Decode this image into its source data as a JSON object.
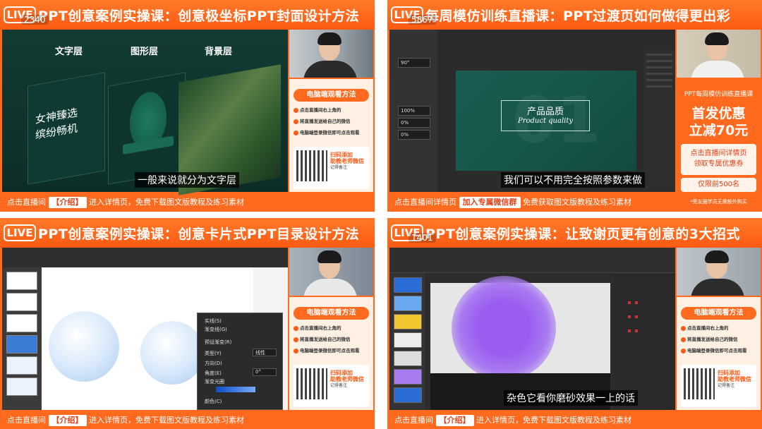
{
  "tiles": [
    {
      "live": "LIVE",
      "viewers": "2340",
      "title": "PPT创意案例实操课：创意极坐标PPT封面设计方法",
      "layers": [
        "文字层",
        "图形层",
        "背景层"
      ],
      "slide_text": "女神臻选\n缤纷畅机",
      "caption": "一般来说就分为文字层",
      "bottom_prefix": "点击直播间",
      "bottom_tag": "【介绍】",
      "bottom_suffix": "进入详情页，免费下载图文版教程及练习素材"
    },
    {
      "live": "LIVE",
      "viewers": "5867",
      "title": "每周模仿训练直播课：PPT过渡页如何做得更出彩",
      "fields": [
        "90°",
        "100%",
        "0%",
        "0%"
      ],
      "slide_cn": "产品品质",
      "slide_en": "Product quality",
      "slide_num": "01",
      "caption": "我们可以不用完全按照参数来做",
      "bottom_prefix": "点击直播间详情页",
      "bottom_tag": "加入专属微信群",
      "bottom_suffix": "免费获取图文版教程及练习素材",
      "promo_top": "PPT每周模仿训练直播课",
      "promo_line1": "首发优惠",
      "promo_line2": "立减70元",
      "promo_box1": "点击直播间详情页",
      "promo_box2": "领取专属优惠券",
      "promo_count": "仅限前500名",
      "promo_foot": "*旁友圈学员无需额外购买"
    },
    {
      "live": "LIVE",
      "title": "PPT创意案例实操课：创意卡片式PPT目录设计方法",
      "dialog_rows": [
        "实线(S)",
        "渐变线(G)",
        "预设渐变(R)",
        "类型(Y)",
        "方向(D)",
        "角度(E)",
        "渐变光圈",
        "颜色(C)"
      ],
      "dialog_values": [
        "线性",
        "0°"
      ],
      "bottom_prefix": "点击直播间",
      "bottom_tag": "【介绍】",
      "bottom_suffix": "进入详情页，免费下载图文版教程及练习素材"
    },
    {
      "live": "LIVE",
      "viewers": "1401",
      "title": "PPT创意案例实操课：让致谢页更有创意的3大招式",
      "caption": "杂色它看你磨砂效果一上的话",
      "bottom_prefix": "点击直播间",
      "bottom_tag": "【介绍】",
      "bottom_suffix": "进入详情页，免费下载图文版教程及练习素材"
    }
  ],
  "side": {
    "header": "电脑端观看方法",
    "steps": [
      "点击直播间右上角的",
      "将直播发送给自己的微信",
      "电脑端登录微信即可点击观看"
    ],
    "qr_title1": "扫码添加",
    "qr_title2": "助教老师微信",
    "qr_note": "记得备注"
  }
}
